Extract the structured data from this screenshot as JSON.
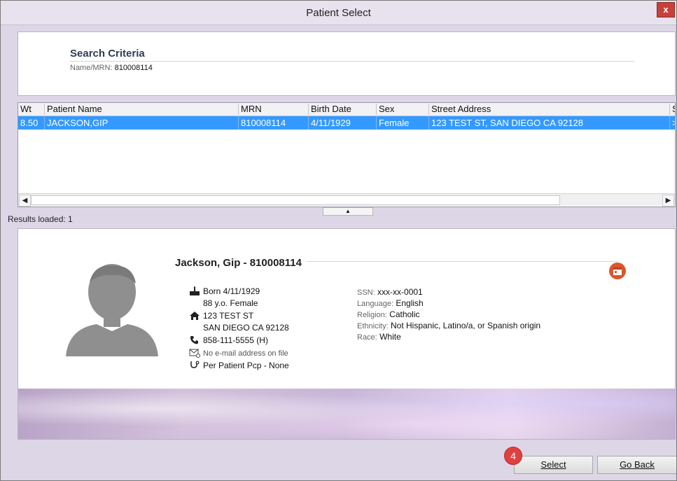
{
  "window": {
    "title": "Patient Select",
    "close_label": "x"
  },
  "search_criteria": {
    "heading": "Search Criteria",
    "label": "Name/MRN:",
    "value": "810008114"
  },
  "grid": {
    "columns": [
      "Wt",
      "Patient Name",
      "MRN",
      "Birth Date",
      "Sex",
      "Street Address",
      "S"
    ],
    "rows": [
      {
        "wt": "8.50",
        "name": "JACKSON,GIP",
        "mrn": "810008114",
        "birth_date": "4/11/1929",
        "sex": "Female",
        "address": "123 TEST ST, SAN DIEGO CA 92128",
        "extra": ">"
      }
    ],
    "selected_row_color": "#3399ff"
  },
  "results_text": "Results loaded: 1",
  "patient": {
    "heading": "Jackson, Gip - 810008114",
    "born": "Born 4/11/1929",
    "age_sex": "88 y.o. Female",
    "address_line1": "123 TEST ST",
    "address_line2": "SAN DIEGO CA 92128",
    "phone": "858-111-5555 (H)",
    "email": "No e-mail address on file",
    "pcp": "Per Patient Pcp - None",
    "demographics": [
      {
        "label": "SSN:",
        "value": "xxx-xx-0001"
      },
      {
        "label": "Language:",
        "value": "English"
      },
      {
        "label": "Religion:",
        "value": "Catholic"
      },
      {
        "label": "Ethnicity:",
        "value": "Not Hispanic, Latino/a, or Spanish origin"
      },
      {
        "label": "Race:",
        "value": "White"
      }
    ],
    "icons": [
      "cake-icon",
      "home-icon",
      "phone-icon",
      "email-icon",
      "stethoscope-icon",
      "calendar-icon"
    ]
  },
  "buttons": {
    "select": "Select",
    "go_back": "Go Back",
    "badge": "4"
  },
  "colors": {
    "accent": "#3399ff",
    "calendar_icon": "#d9572b",
    "badge": "#e04040"
  }
}
